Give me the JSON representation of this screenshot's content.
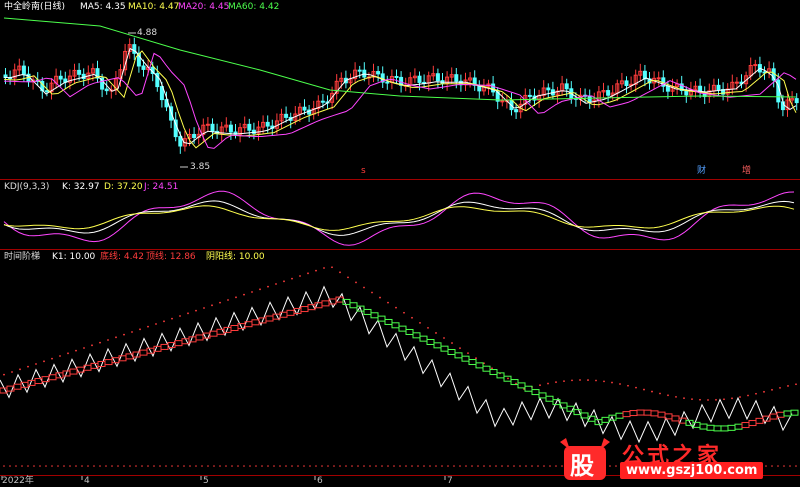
{
  "colors": {
    "up": "#ff3c3c",
    "down": "#54ffff",
    "ma5": "#ffffff",
    "ma10": "#ffff4f",
    "ma20": "#ff46ff",
    "ma60": "#4cff4c",
    "grid": "#8b0000",
    "axis": "#c0c0c0"
  },
  "main": {
    "stock_label": "中全岭南(日线)",
    "ma5_label": "MA5: 4.35",
    "ma10_label": "MA10: 4.47",
    "ma20_label": "MA20: 4.45",
    "ma60_label": "MA60: 4.42",
    "high_label": "4.88",
    "low_label": "3.85",
    "marker_s": "s",
    "marker_cai": "财",
    "marker_zeng": "增"
  },
  "kdj": {
    "title": "KDJ(9,3,3)",
    "k_label": "K: 32.97",
    "d_label": "D: 37.20",
    "j_label": "J: 24.51"
  },
  "ladder": {
    "title": "时间阶梯",
    "k1_label": "K1: 10.00",
    "bottom_label": "底线: 4.42",
    "top_label": "顶线: 12.86",
    "yinyang_label": "阴阳线: 10.00"
  },
  "xaxis": {
    "ticks": [
      "2022年",
      "4",
      "5",
      "6",
      "7"
    ]
  },
  "watermark": {
    "badge": "股",
    "text": "公式之家",
    "url": "www.gszj100.com"
  },
  "chart_data": {
    "type": "line",
    "x": [
      "2022年",
      "4",
      "5",
      "6",
      "7"
    ],
    "series": [
      {
        "name": "MA5",
        "values": [
          4.35
        ]
      },
      {
        "name": "MA10",
        "values": [
          4.47
        ]
      },
      {
        "name": "MA20",
        "values": [
          4.45
        ]
      },
      {
        "name": "MA60",
        "values": [
          4.42
        ]
      },
      {
        "name": "K",
        "values": [
          32.97
        ]
      },
      {
        "name": "D",
        "values": [
          37.2
        ]
      },
      {
        "name": "J",
        "values": [
          24.51
        ]
      },
      {
        "name": "K1",
        "values": [
          10.0
        ]
      }
    ],
    "price_high": 4.88,
    "price_low": 3.85,
    "ladder_bottom": 4.42,
    "ladder_top": 12.86,
    "yinyang": 10.0,
    "grid": false
  }
}
